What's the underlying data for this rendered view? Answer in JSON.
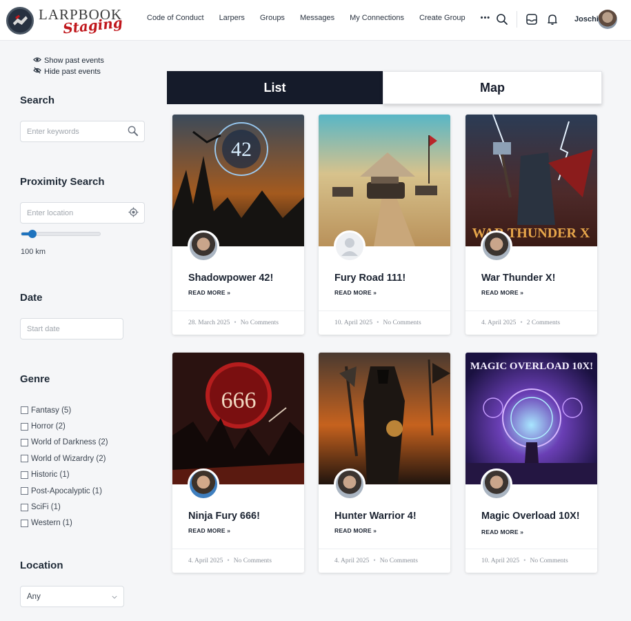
{
  "header": {
    "logo_text": "LARPBOOK",
    "logo_sub": "Staging",
    "nav": [
      "Code of Conduct",
      "Larpers",
      "Groups",
      "Messages",
      "My Connections",
      "Create Group"
    ],
    "nav_more": "•••",
    "user_name": "Joschi"
  },
  "sidebar": {
    "show_past": "Show past events",
    "hide_past": "Hide past events",
    "search_title": "Search",
    "search_placeholder": "Enter keywords",
    "proximity_title": "Proximity Search",
    "location_placeholder": "Enter location",
    "radius_value": "100 km",
    "radius_fraction": 0.14,
    "date_title": "Date",
    "date_placeholder": "Start date",
    "genre_title": "Genre",
    "genres": [
      "Fantasy (5)",
      "Horror (2)",
      "World of Darkness (2)",
      "World of Wizardry (2)",
      "Historic (1)",
      "Post-Apocalyptic (1)",
      "SciFi (1)",
      "Western (1)"
    ],
    "location_title": "Location",
    "location_select": "Any"
  },
  "tabs": {
    "list": "List",
    "map": "Map"
  },
  "read_more": "READ MORE »",
  "cards": [
    {
      "title": "Shadowpower 42!",
      "date": "28. March 2025",
      "comments": "No Comments",
      "image_text": "42"
    },
    {
      "title": "Fury Road 111!",
      "date": "10. April 2025",
      "comments": "No Comments",
      "image_text": ""
    },
    {
      "title": "War Thunder X!",
      "date": "4. April 2025",
      "comments": "2 Comments",
      "image_text": "WAR THUNDER X"
    },
    {
      "title": "Ninja Fury 666!",
      "date": "4. April 2025",
      "comments": "No Comments",
      "image_text": "666"
    },
    {
      "title": "Hunter Warrior 4!",
      "date": "4. April 2025",
      "comments": "No Comments",
      "image_text": ""
    },
    {
      "title": "Magic Overload 10X!",
      "date": "10. April 2025",
      "comments": "No Comments",
      "image_text": "MAGIC OVERLOAD 10X!"
    }
  ],
  "separator": "•"
}
